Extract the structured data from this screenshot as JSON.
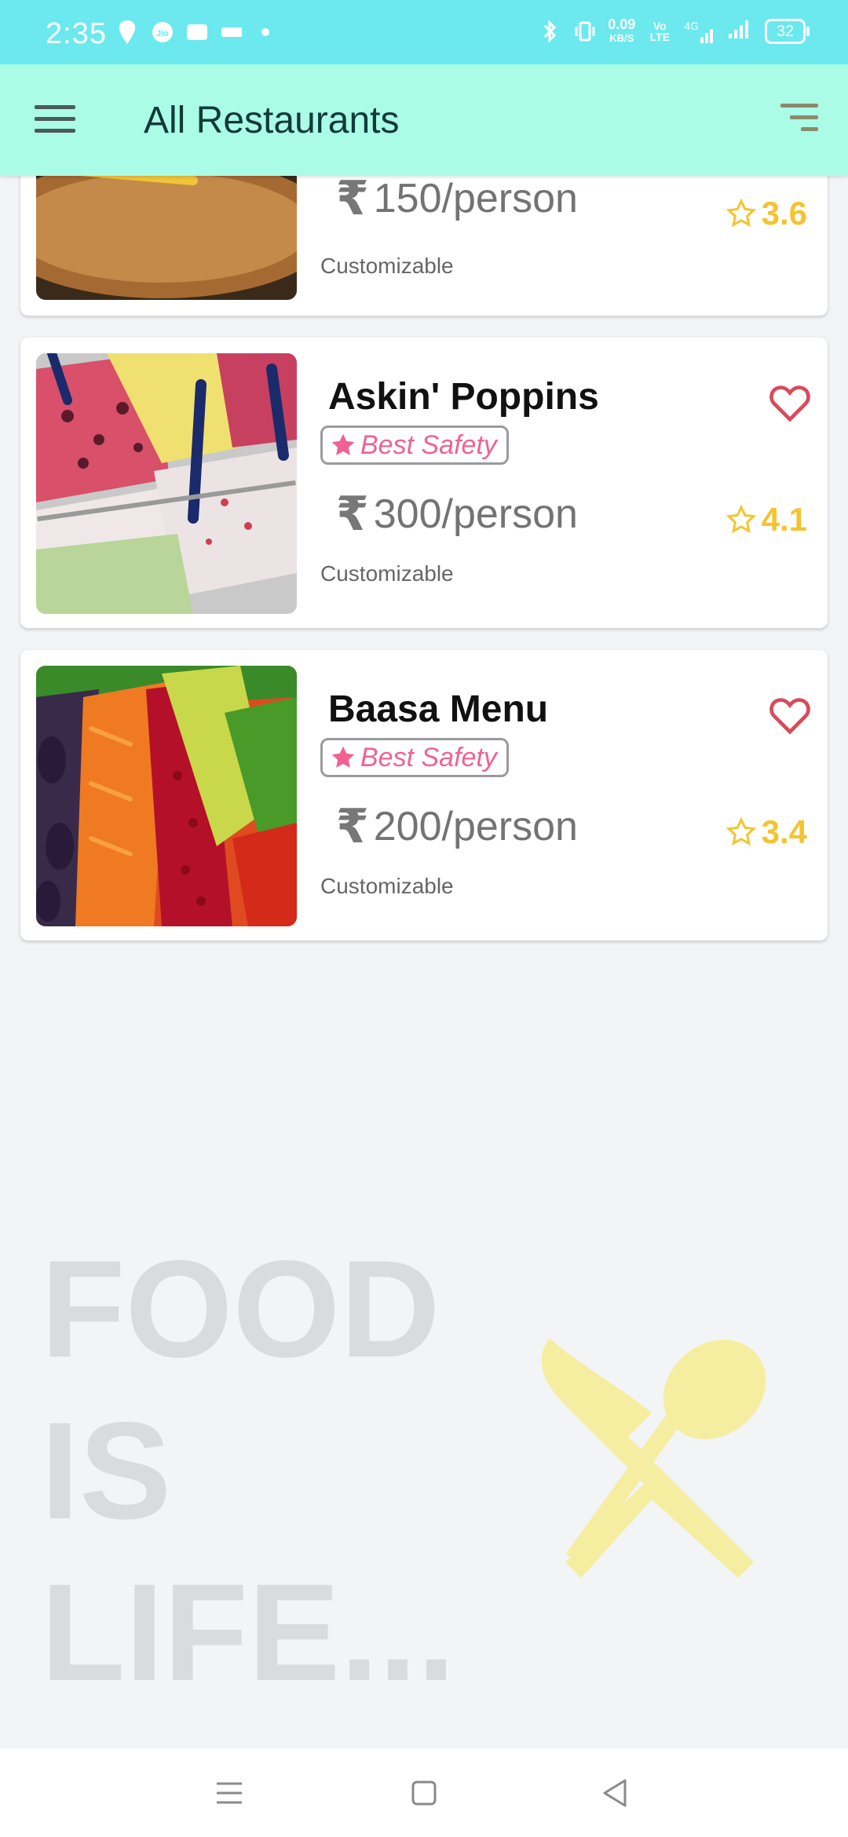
{
  "status_bar": {
    "time": "2:35",
    "net_speed_value": "0.09",
    "net_speed_unit": "KB/S",
    "volte_label": "Vo LTE",
    "network_label": "4G",
    "battery": "32"
  },
  "app_bar": {
    "title": "All Restaurants"
  },
  "restaurants": [
    {
      "name": "",
      "price_symbol": "₹",
      "price": "150/person",
      "customizable": "Customizable",
      "rating": "3.6"
    },
    {
      "name": "Askin' Poppins",
      "safety_badge": "Best Safety",
      "price_symbol": "₹",
      "price": "300/person",
      "customizable": "Customizable",
      "rating": "4.1"
    },
    {
      "name": "Baasa Menu",
      "safety_badge": "Best Safety",
      "price_symbol": "₹",
      "price": "200/person",
      "customizable": "Customizable",
      "rating": "3.4"
    }
  ],
  "background": {
    "slogan_line1": "FOOD",
    "slogan_line2": "IS",
    "slogan_line3": "LIFE..."
  },
  "icons": {
    "menu": "hamburger-menu-icon",
    "filter": "sort-filter-icon",
    "heart": "heart-outline-icon",
    "star": "star-outline-icon",
    "cutlery": "knife-spoon-icon"
  },
  "colors": {
    "status_bar": "#6be9ef",
    "app_bar": "#aafce6",
    "rating": "#f4c430",
    "safety": "#f06292",
    "heart": "#d94a5a"
  }
}
